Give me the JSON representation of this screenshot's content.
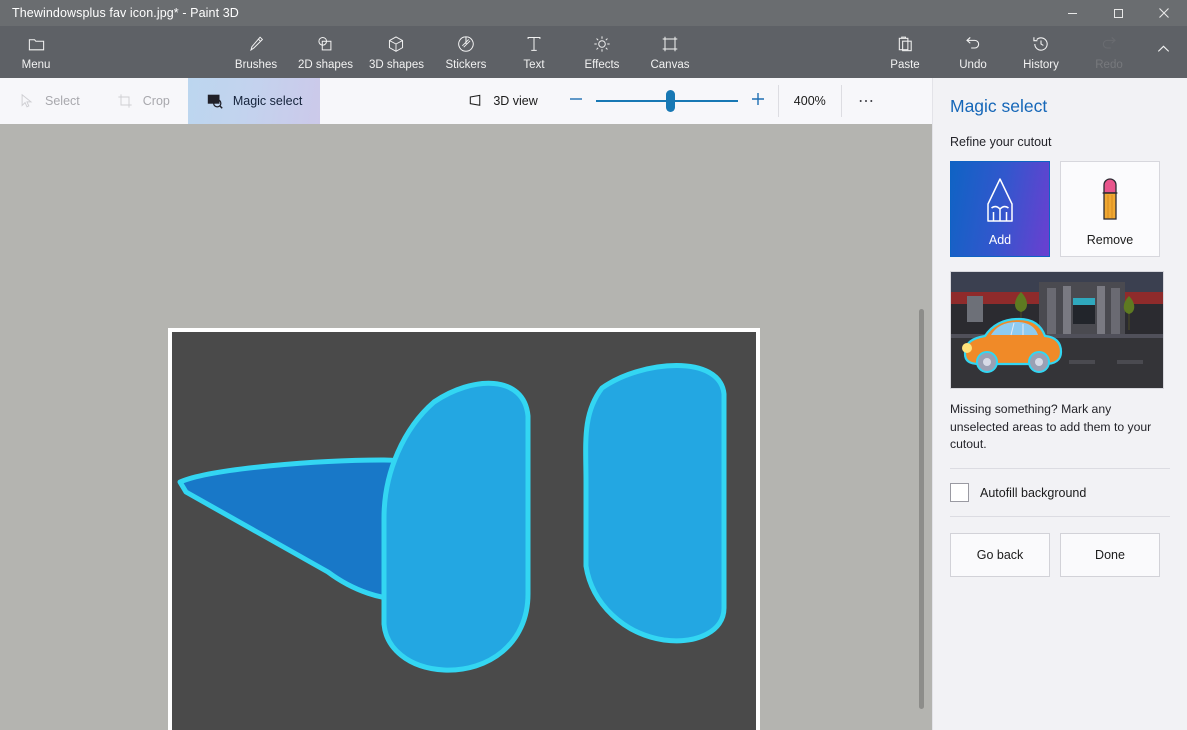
{
  "window": {
    "title": "Thewindowsplus fav icon.jpg* - Paint 3D",
    "controls": {
      "minimize": "minimize-icon",
      "maximize": "maximize-icon",
      "close": "close-icon"
    }
  },
  "ribbon": {
    "menu": {
      "label": "Menu",
      "icon": "folder-icon"
    },
    "center_items": [
      {
        "label": "Brushes",
        "icon": "brush-icon"
      },
      {
        "label": "2D shapes",
        "icon": "2d-shapes-icon"
      },
      {
        "label": "3D shapes",
        "icon": "3d-shapes-icon"
      },
      {
        "label": "Stickers",
        "icon": "stickers-icon"
      },
      {
        "label": "Text",
        "icon": "text-icon"
      },
      {
        "label": "Effects",
        "icon": "effects-icon"
      },
      {
        "label": "Canvas",
        "icon": "canvas-icon"
      }
    ],
    "right_items": [
      {
        "label": "Paste",
        "icon": "paste-icon",
        "enabled": true
      },
      {
        "label": "Undo",
        "icon": "undo-icon",
        "enabled": true
      },
      {
        "label": "History",
        "icon": "history-icon",
        "enabled": true
      },
      {
        "label": "Redo",
        "icon": "redo-icon",
        "enabled": false
      }
    ],
    "collapse": "chevron-up-icon"
  },
  "subbar": {
    "tools": [
      {
        "label": "Select",
        "icon": "cursor-icon",
        "state": "disabled"
      },
      {
        "label": "Crop",
        "icon": "crop-icon",
        "state": "disabled"
      },
      {
        "label": "Magic select",
        "icon": "magic-select-icon",
        "state": "active"
      }
    ],
    "view_3d": {
      "label": "3D view",
      "icon": "3d-view-icon"
    },
    "zoom_out": "minus-icon",
    "zoom_in": "plus-icon",
    "zoom_level": "400%",
    "more": "ellipsis-icon"
  },
  "panel": {
    "title": "Magic select",
    "subtitle": "Refine your cutout",
    "modes": [
      {
        "label": "Add",
        "icon": "pencil-icon",
        "selected": true
      },
      {
        "label": "Remove",
        "icon": "eraser-icon",
        "selected": false
      }
    ],
    "preview_alt": "orange-car-street-illustration",
    "hint": "Missing something? Mark any unselected areas to add them to your cutout.",
    "autofill": {
      "label": "Autofill background",
      "checked": false
    },
    "buttons": [
      {
        "label": "Go back"
      },
      {
        "label": "Done"
      }
    ]
  },
  "canvas": {
    "artwork": "blue-w-logo-cutout",
    "background_color": "#4a4a4a",
    "selection_outline_color": "#33d6f2",
    "shape_colors": {
      "left_wing": "#1878c8",
      "right_shapes": "#23a7e2"
    }
  },
  "colors": {
    "titlebar": "#6a6d70",
    "ribbon": "#5e6166",
    "subbar": "#f7f7fa",
    "workspace": "#b4b4b0",
    "panel": "#f2f2f5",
    "accent_blue": "#1667b8",
    "slider_blue": "#1878b4"
  }
}
